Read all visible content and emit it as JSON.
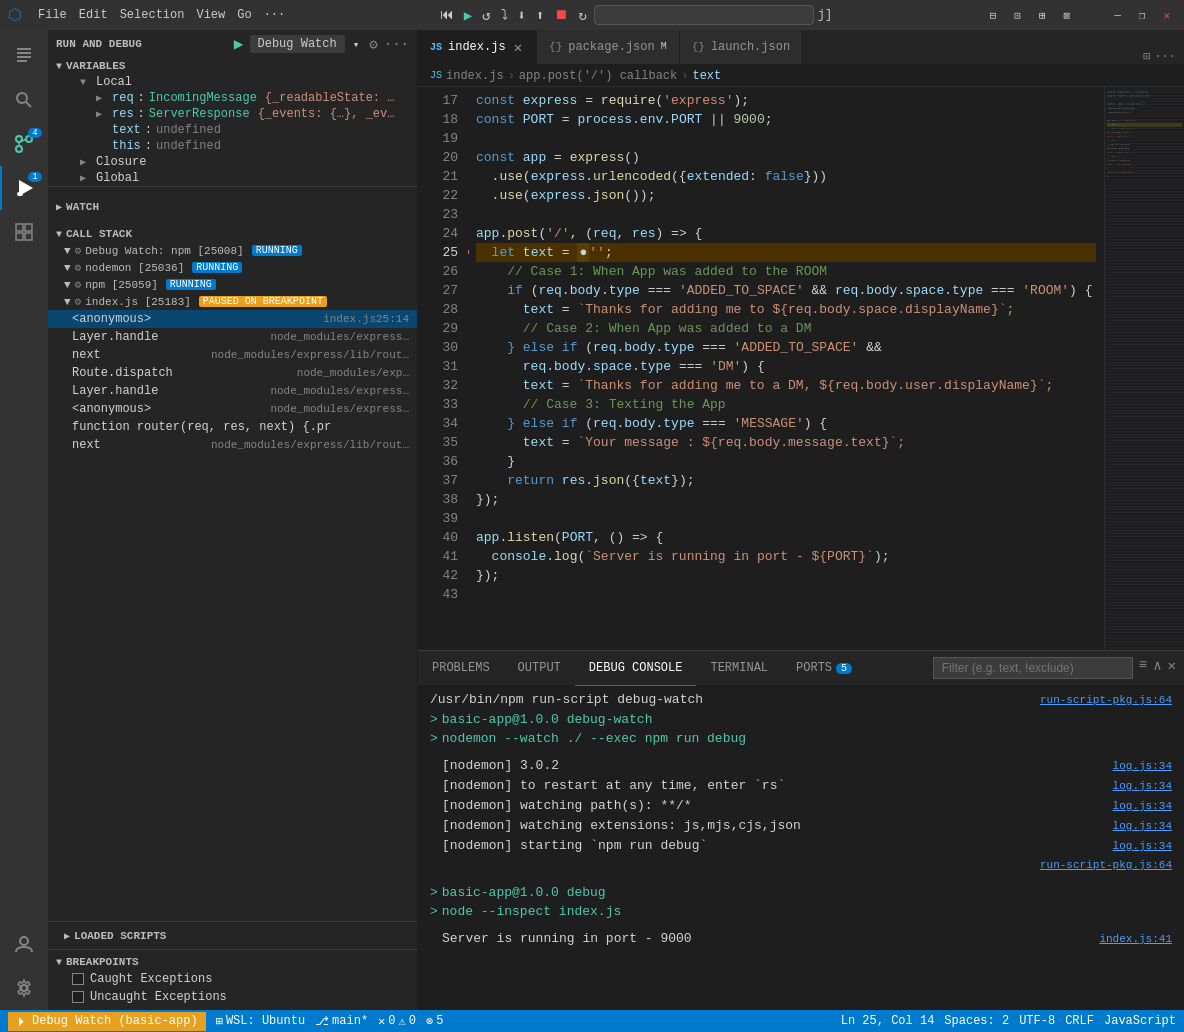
{
  "titlebar": {
    "icon": "⬡",
    "menus": [
      "File",
      "Edit",
      "Selection",
      "View",
      "Go",
      "···"
    ],
    "debug_controls": [
      "⏮",
      "▶",
      "↺",
      "⬇",
      "⬆",
      "⤷",
      "⏹",
      "↻"
    ],
    "search_placeholder": "",
    "search_value": "",
    "window_controls": [
      "—",
      "❐",
      "✕"
    ]
  },
  "sidebar": {
    "run_debug_label": "RUN AND DEBUG",
    "debug_config": "Debug Watch",
    "config_icon": "▶",
    "settings_icon": "⚙",
    "more_icon": "···",
    "variables": {
      "label": "VARIABLES",
      "local": {
        "label": "Local",
        "items": [
          {
            "name": "req",
            "type": "IncomingMessage",
            "value": "{_readableState: …",
            "expandable": true
          },
          {
            "name": "res",
            "type": "ServerResponse",
            "value": "{_events: {…}, _ev…",
            "expandable": true
          },
          {
            "name": "text",
            "type": "",
            "value": "undefined"
          },
          {
            "name": "this",
            "type": "",
            "value": "undefined"
          }
        ]
      },
      "closure": {
        "label": "Closure",
        "expandable": true
      },
      "global": {
        "label": "Global",
        "expandable": true
      }
    },
    "watch": {
      "label": "WATCH"
    },
    "call_stack": {
      "label": "CALL STACK",
      "groups": [
        {
          "name": "Debug Watch: npm [25008]",
          "badge": "RUNNING",
          "badge_type": "running",
          "expanded": true
        },
        {
          "name": "nodemon [25036]",
          "badge": "RUNNING",
          "badge_type": "running",
          "expanded": true
        },
        {
          "name": "npm [25059]",
          "badge": "RUNNING",
          "badge_type": "running",
          "expanded": true
        },
        {
          "name": "index.js [25183]",
          "badge": "PAUSED ON BREAKPOINT",
          "badge_type": "paused",
          "expanded": true
        }
      ],
      "frames": [
        {
          "name": "<anonymous>",
          "file": "index.js",
          "line": "25:14",
          "selected": true
        },
        {
          "name": "Layer.handle",
          "file": "node_modules/express…",
          "line": ""
        },
        {
          "name": "next",
          "file": "node_modules/express/lib/rout…",
          "line": ""
        },
        {
          "name": "Route.dispatch",
          "file": "node_modules/exp…",
          "line": ""
        },
        {
          "name": "Layer.handle",
          "file": "node_modules/express…",
          "line": ""
        },
        {
          "name": "<anonymous>",
          "file": "node_modules/express…",
          "line": ""
        },
        {
          "name": "function router(req, res, next) {.pr",
          "file": "",
          "line": ""
        },
        {
          "name": "next",
          "file": "node_modules/express/lib/rout…",
          "line": ""
        }
      ]
    },
    "loaded_scripts": {
      "label": "LOADED SCRIPTS"
    },
    "breakpoints": {
      "label": "BREAKPOINTS",
      "items": [
        {
          "label": "Caught Exceptions",
          "checked": false
        },
        {
          "label": "Uncaught Exceptions",
          "checked": false
        }
      ]
    }
  },
  "editor": {
    "tabs": [
      {
        "label": "index.js",
        "icon": "JS",
        "active": true,
        "modified": false
      },
      {
        "label": "package.json",
        "icon": "{}",
        "active": false,
        "modified": true
      },
      {
        "label": "launch.json",
        "icon": "{}",
        "active": false,
        "modified": false
      }
    ],
    "breadcrumb": [
      "index.js",
      "app.post('/') callback",
      "text"
    ],
    "lines": [
      {
        "num": 17,
        "tokens": [
          {
            "t": "const ",
            "c": "kw"
          },
          {
            "t": "express",
            "c": "var-ref"
          },
          {
            "t": " = ",
            "c": "op"
          },
          {
            "t": "require",
            "c": "fn"
          },
          {
            "t": "(",
            "c": "op"
          },
          {
            "t": "'express'",
            "c": "str"
          },
          {
            "t": ");",
            "c": "op"
          }
        ]
      },
      {
        "num": 18,
        "tokens": [
          {
            "t": "const ",
            "c": "kw"
          },
          {
            "t": "PORT",
            "c": "var-ref"
          },
          {
            "t": " = ",
            "c": "op"
          },
          {
            "t": "process",
            "c": "var-ref"
          },
          {
            "t": ".",
            "c": "op"
          },
          {
            "t": "env",
            "c": "prop"
          },
          {
            "t": ".",
            "c": "op"
          },
          {
            "t": "PORT",
            "c": "prop"
          },
          {
            "t": " || ",
            "c": "op"
          },
          {
            "t": "9000",
            "c": "num"
          },
          {
            "t": ";",
            "c": "op"
          }
        ]
      },
      {
        "num": 19,
        "tokens": []
      },
      {
        "num": 20,
        "tokens": [
          {
            "t": "const ",
            "c": "kw"
          },
          {
            "t": "app",
            "c": "var-ref"
          },
          {
            "t": " = ",
            "c": "op"
          },
          {
            "t": "express",
            "c": "fn"
          },
          {
            "t": "()",
            "c": "op"
          }
        ]
      },
      {
        "num": 21,
        "tokens": [
          {
            "t": "  .",
            "c": "op"
          },
          {
            "t": "use",
            "c": "method"
          },
          {
            "t": "(",
            "c": "op"
          },
          {
            "t": "express",
            "c": "var-ref"
          },
          {
            "t": ".",
            "c": "op"
          },
          {
            "t": "urlencoded",
            "c": "method"
          },
          {
            "t": "({",
            "c": "op"
          },
          {
            "t": "extended",
            "c": "prop"
          },
          {
            "t": ": ",
            "c": "op"
          },
          {
            "t": "false",
            "c": "kw"
          },
          {
            "t": "}))",
            "c": "op"
          }
        ]
      },
      {
        "num": 22,
        "tokens": [
          {
            "t": "  .",
            "c": "op"
          },
          {
            "t": "use",
            "c": "method"
          },
          {
            "t": "(",
            "c": "op"
          },
          {
            "t": "express",
            "c": "var-ref"
          },
          {
            "t": ".",
            "c": "op"
          },
          {
            "t": "json",
            "c": "method"
          },
          {
            "t": "());",
            "c": "op"
          }
        ]
      },
      {
        "num": 23,
        "tokens": []
      },
      {
        "num": 24,
        "tokens": [
          {
            "t": "app",
            "c": "var-ref"
          },
          {
            "t": ".",
            "c": "op"
          },
          {
            "t": "post",
            "c": "method"
          },
          {
            "t": "(",
            "c": "op"
          },
          {
            "t": "'/'",
            "c": "str"
          },
          {
            "t": ", (",
            "c": "op"
          },
          {
            "t": "req",
            "c": "var-ref"
          },
          {
            "t": ", ",
            "c": "op"
          },
          {
            "t": "res",
            "c": "var-ref"
          },
          {
            "t": ") => {",
            "c": "op"
          }
        ]
      },
      {
        "num": 25,
        "tokens": [
          {
            "t": "  ",
            "c": "op"
          },
          {
            "t": "let ",
            "c": "kw"
          },
          {
            "t": "text",
            "c": "var-ref"
          },
          {
            "t": " = ",
            "c": "op"
          },
          {
            "t": "''",
            "c": "str"
          },
          {
            "t": ";",
            "c": "op"
          }
        ],
        "active": true,
        "breakpoint": true
      },
      {
        "num": 26,
        "tokens": [
          {
            "t": "  ",
            "c": "op"
          },
          {
            "t": "// Case 1: When App was added to the ROOM",
            "c": "comment"
          }
        ]
      },
      {
        "num": 27,
        "tokens": [
          {
            "t": "  ",
            "c": "op"
          },
          {
            "t": "if",
            "c": "kw"
          },
          {
            "t": " (",
            "c": "op"
          },
          {
            "t": "req",
            "c": "var-ref"
          },
          {
            "t": ".",
            "c": "op"
          },
          {
            "t": "body",
            "c": "prop"
          },
          {
            "t": ".",
            "c": "op"
          },
          {
            "t": "type",
            "c": "prop"
          },
          {
            "t": " === ",
            "c": "op"
          },
          {
            "t": "'ADDED_TO_SPACE'",
            "c": "str"
          },
          {
            "t": " && ",
            "c": "op"
          },
          {
            "t": "req",
            "c": "var-ref"
          },
          {
            "t": ".",
            "c": "op"
          },
          {
            "t": "body",
            "c": "prop"
          },
          {
            "t": ".",
            "c": "op"
          },
          {
            "t": "space",
            "c": "prop"
          },
          {
            "t": ".",
            "c": "op"
          },
          {
            "t": "type",
            "c": "prop"
          },
          {
            "t": " === ",
            "c": "op"
          },
          {
            "t": "'ROOM'",
            "c": "str"
          },
          {
            "t": ") {",
            "c": "op"
          }
        ]
      },
      {
        "num": 28,
        "tokens": [
          {
            "t": "    ",
            "c": "op"
          },
          {
            "t": "text",
            "c": "var-ref"
          },
          {
            "t": " = ",
            "c": "op"
          },
          {
            "t": "`Thanks for adding me to ${req.body.space.displayName}`;",
            "c": "str"
          }
        ]
      },
      {
        "num": 29,
        "tokens": [
          {
            "t": "    ",
            "c": "op"
          },
          {
            "t": "// Case 2: When App was added to a DM",
            "c": "comment"
          }
        ]
      },
      {
        "num": 30,
        "tokens": [
          {
            "t": "  ",
            "c": "op"
          },
          {
            "t": "} else if",
            "c": "kw"
          },
          {
            "t": " (",
            "c": "op"
          },
          {
            "t": "req",
            "c": "var-ref"
          },
          {
            "t": ".",
            "c": "op"
          },
          {
            "t": "body",
            "c": "prop"
          },
          {
            "t": ".",
            "c": "op"
          },
          {
            "t": "type",
            "c": "prop"
          },
          {
            "t": " === ",
            "c": "op"
          },
          {
            "t": "'ADDED_TO_SPACE'",
            "c": "str"
          },
          {
            "t": " &&",
            "c": "op"
          }
        ]
      },
      {
        "num": 31,
        "tokens": [
          {
            "t": "    ",
            "c": "op"
          },
          {
            "t": "req",
            "c": "var-ref"
          },
          {
            "t": ".",
            "c": "op"
          },
          {
            "t": "body",
            "c": "prop"
          },
          {
            "t": ".",
            "c": "op"
          },
          {
            "t": "space",
            "c": "prop"
          },
          {
            "t": ".",
            "c": "op"
          },
          {
            "t": "type",
            "c": "prop"
          },
          {
            "t": " === ",
            "c": "op"
          },
          {
            "t": "'DM'",
            "c": "str"
          },
          {
            "t": ") {",
            "c": "op"
          }
        ]
      },
      {
        "num": 32,
        "tokens": [
          {
            "t": "    ",
            "c": "op"
          },
          {
            "t": "text",
            "c": "var-ref"
          },
          {
            "t": " = ",
            "c": "op"
          },
          {
            "t": "`Thanks for adding me to a DM, ${req.body.user.displayName}`;",
            "c": "str"
          }
        ]
      },
      {
        "num": 33,
        "tokens": [
          {
            "t": "    ",
            "c": "op"
          },
          {
            "t": "// Case 3: Texting the App",
            "c": "comment"
          }
        ]
      },
      {
        "num": 34,
        "tokens": [
          {
            "t": "  ",
            "c": "op"
          },
          {
            "t": "} else if",
            "c": "kw"
          },
          {
            "t": " (",
            "c": "op"
          },
          {
            "t": "req",
            "c": "var-ref"
          },
          {
            "t": ".",
            "c": "op"
          },
          {
            "t": "body",
            "c": "prop"
          },
          {
            "t": ".",
            "c": "op"
          },
          {
            "t": "type",
            "c": "prop"
          },
          {
            "t": " === ",
            "c": "op"
          },
          {
            "t": "'MESSAGE'",
            "c": "str"
          },
          {
            "t": ") {",
            "c": "op"
          }
        ]
      },
      {
        "num": 35,
        "tokens": [
          {
            "t": "    ",
            "c": "op"
          },
          {
            "t": "text",
            "c": "var-ref"
          },
          {
            "t": " = ",
            "c": "op"
          },
          {
            "t": "`Your message : ${req.body.message.text}`;",
            "c": "str"
          }
        ]
      },
      {
        "num": 36,
        "tokens": [
          {
            "t": "  ",
            "c": "op"
          },
          {
            "t": "}",
            "c": "op"
          }
        ]
      },
      {
        "num": 37,
        "tokens": [
          {
            "t": "  ",
            "c": "op"
          },
          {
            "t": "return ",
            "c": "kw"
          },
          {
            "t": "res",
            "c": "var-ref"
          },
          {
            "t": ".",
            "c": "op"
          },
          {
            "t": "json",
            "c": "method"
          },
          {
            "t": "({",
            "c": "op"
          },
          {
            "t": "text",
            "c": "prop"
          },
          {
            "t": "});",
            "c": "op"
          }
        ]
      },
      {
        "num": 38,
        "tokens": [
          {
            "t": "});",
            "c": "op"
          }
        ]
      },
      {
        "num": 39,
        "tokens": []
      },
      {
        "num": 40,
        "tokens": [
          {
            "t": "app",
            "c": "var-ref"
          },
          {
            "t": ".",
            "c": "op"
          },
          {
            "t": "listen",
            "c": "method"
          },
          {
            "t": "(",
            "c": "op"
          },
          {
            "t": "PORT",
            "c": "var-ref"
          },
          {
            "t": ", () => {",
            "c": "op"
          }
        ]
      },
      {
        "num": 41,
        "tokens": [
          {
            "t": "  ",
            "c": "op"
          },
          {
            "t": "console",
            "c": "var-ref"
          },
          {
            "t": ".",
            "c": "op"
          },
          {
            "t": "log",
            "c": "method"
          },
          {
            "t": "(",
            "c": "op"
          },
          {
            "t": "`Server is running in port - ${PORT}`",
            "c": "str"
          },
          {
            "t": ");",
            "c": "op"
          }
        ]
      },
      {
        "num": 42,
        "tokens": [
          {
            "t": "});",
            "c": "op"
          }
        ]
      },
      {
        "num": 43,
        "tokens": []
      }
    ]
  },
  "bottom_panel": {
    "tabs": [
      {
        "label": "PROBLEMS",
        "badge": null,
        "active": false
      },
      {
        "label": "OUTPUT",
        "badge": null,
        "active": false
      },
      {
        "label": "DEBUG CONSOLE",
        "badge": null,
        "active": true
      },
      {
        "label": "TERMINAL",
        "badge": null,
        "active": false
      },
      {
        "label": "PORTS",
        "badge": "5",
        "active": false
      }
    ],
    "filter_placeholder": "Filter (e.g. text, !exclude)",
    "console_output": [
      {
        "type": "cmd",
        "text": "/usr/bin/npm run-script debug-watch",
        "loc": "run-script-pkg.js:64"
      },
      {
        "type": "cmd-noref",
        "text": "> basic-app@1.0.0 debug-watch"
      },
      {
        "type": "cmd-noref",
        "text": "> nodemon --watch ./ --exec npm run debug"
      },
      {
        "type": "empty"
      },
      {
        "type": "plain",
        "text": "[nodemon] 3.0.2",
        "loc": "log.js:34"
      },
      {
        "type": "plain",
        "text": "[nodemon] to restart at any time, enter `rs`",
        "loc": "log.js:34"
      },
      {
        "type": "plain",
        "text": "[nodemon] watching path(s): **/*",
        "loc": "log.js:34"
      },
      {
        "type": "plain",
        "text": "[nodemon] watching extensions: js,mjs,cjs,json",
        "loc": "log.js:34"
      },
      {
        "type": "plain",
        "text": "[nodemon] starting `npm run debug`",
        "loc": "log.js:34"
      },
      {
        "type": "cmd-ref",
        "text": "",
        "loc": "run-script-pkg.js:64"
      },
      {
        "type": "empty"
      },
      {
        "type": "cmd-noref",
        "text": "> basic-app@1.0.0 debug"
      },
      {
        "type": "cmd-noref",
        "text": "> node --inspect index.js"
      },
      {
        "type": "empty"
      },
      {
        "type": "plain-white",
        "text": "Server is running in port - 9000",
        "loc": "index.js:41"
      }
    ]
  },
  "status_bar": {
    "debug_label": "Debug Watch (basic-app)",
    "wsl": "WSL: Ubuntu",
    "branch": "main*",
    "errors": "0",
    "warnings": "0",
    "ports": "5",
    "cursor": "Ln 25, Col 14",
    "spaces": "Spaces: 2",
    "encoding": "UTF-8",
    "line_ending": "CRLF",
    "language": "JavaScript"
  }
}
